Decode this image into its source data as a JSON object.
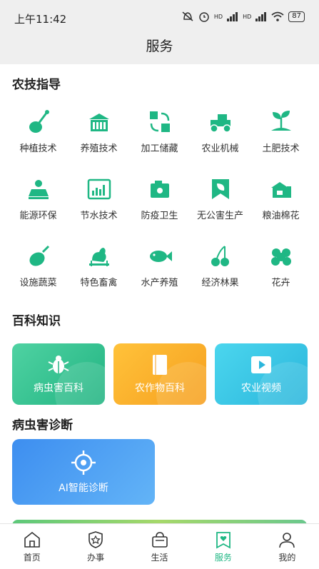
{
  "status": {
    "time": "上午11:42",
    "battery": "87",
    "hd1": "HD",
    "hd2": "HD"
  },
  "header": {
    "title": "服务"
  },
  "agri": {
    "title": "农技指导",
    "items": [
      {
        "label": "种植技术",
        "icon": "shovel-sprout-icon"
      },
      {
        "label": "养殖技术",
        "icon": "barn-icon"
      },
      {
        "label": "加工储藏",
        "icon": "boxes-cycle-icon"
      },
      {
        "label": "农业机械",
        "icon": "tractor-icon"
      },
      {
        "label": "土肥技术",
        "icon": "seedling-soil-icon"
      },
      {
        "label": "能源环保",
        "icon": "solar-panel-icon"
      },
      {
        "label": "节水技术",
        "icon": "water-chart-icon"
      },
      {
        "label": "防疫卫生",
        "icon": "sanitizer-icon"
      },
      {
        "label": "无公害生产",
        "icon": "leaf-badge-icon"
      },
      {
        "label": "粮油棉花",
        "icon": "granary-icon"
      },
      {
        "label": "设施蔬菜",
        "icon": "eggplant-icon"
      },
      {
        "label": "特色畜禽",
        "icon": "rooster-icon"
      },
      {
        "label": "水产养殖",
        "icon": "fish-icon"
      },
      {
        "label": "经济林果",
        "icon": "cherry-icon"
      },
      {
        "label": "花卉",
        "icon": "flower-icon"
      }
    ]
  },
  "encyclopedia": {
    "title": "百科知识",
    "cards": [
      {
        "label": "病虫害百科",
        "icon": "bug-icon"
      },
      {
        "label": "农作物百科",
        "icon": "book-icon"
      },
      {
        "label": "农业视频",
        "icon": "play-icon"
      }
    ]
  },
  "diagnosis": {
    "title": "病虫害诊断",
    "card": {
      "label": "AI智能诊断",
      "icon": "crosshair-icon"
    }
  },
  "tabbar": {
    "items": [
      {
        "label": "首页",
        "icon": "home-icon"
      },
      {
        "label": "办事",
        "icon": "star-shield-icon"
      },
      {
        "label": "生活",
        "icon": "shopping-bag-icon"
      },
      {
        "label": "服务",
        "icon": "heart-bookmark-icon"
      },
      {
        "label": "我的",
        "icon": "user-icon"
      }
    ],
    "active": "服务"
  },
  "colors": {
    "primary": "#1fb784",
    "ency1": "#22b482",
    "ency2": "#f6a020",
    "ency3": "#2bb6dc",
    "ai": "#3d8ef0"
  }
}
